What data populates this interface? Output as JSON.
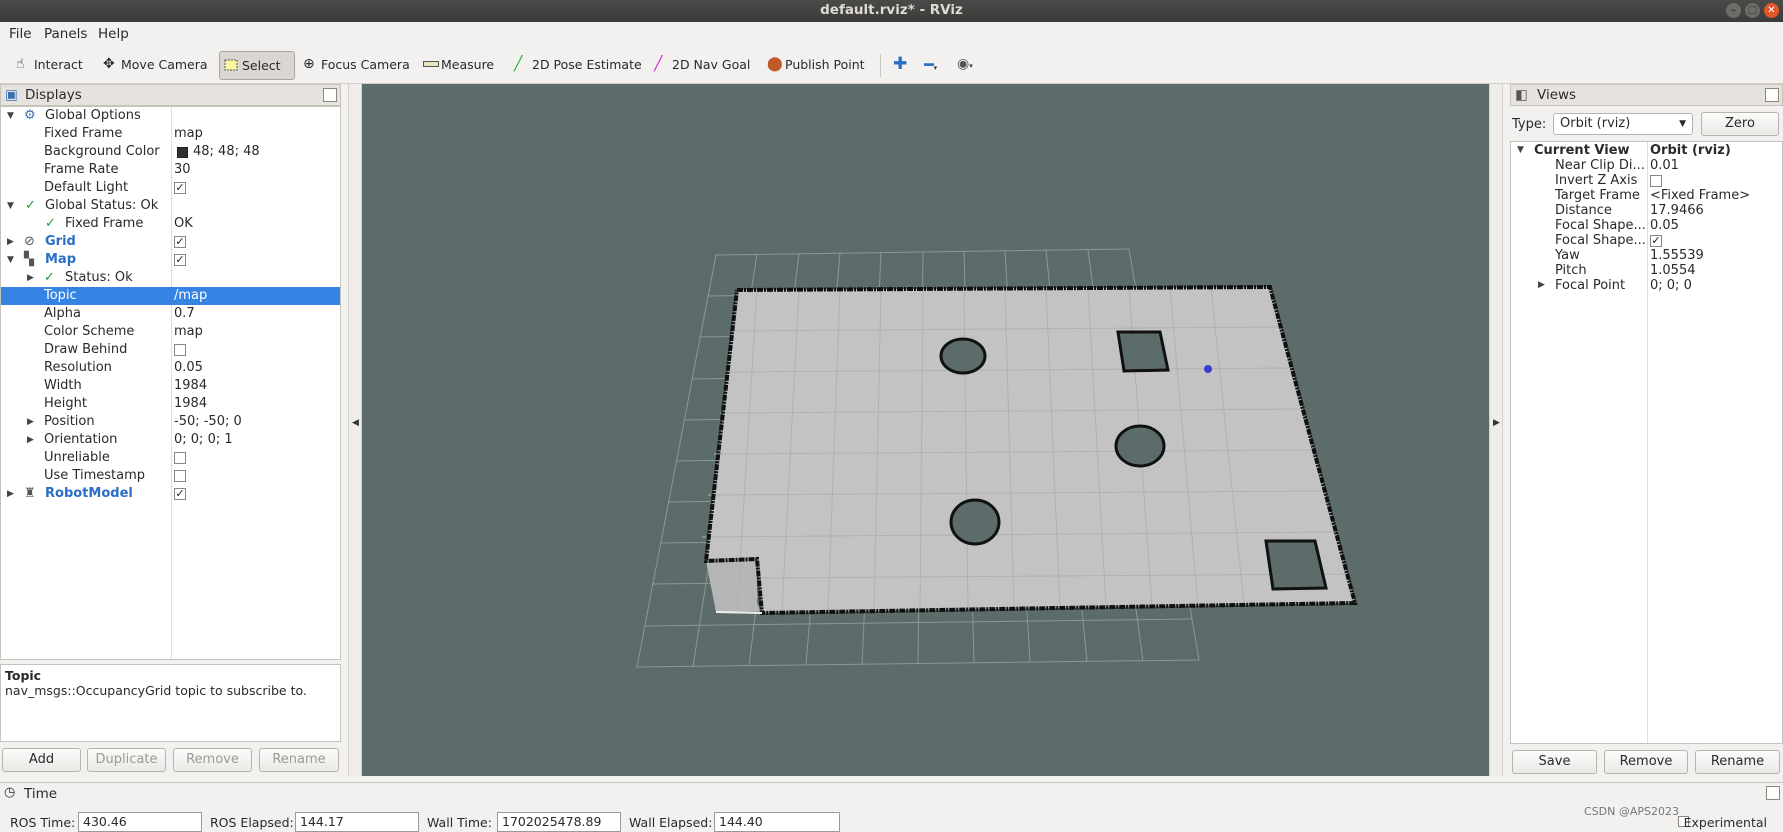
{
  "window": {
    "title": "default.rviz* - RViz"
  },
  "menu": {
    "file": "File",
    "panels": "Panels",
    "help": "Help"
  },
  "toolbar": {
    "interact": "Interact",
    "move_camera": "Move Camera",
    "select": "Select",
    "focus_camera": "Focus Camera",
    "measure": "Measure",
    "pose_estimate": "2D Pose Estimate",
    "nav_goal": "2D Nav Goal",
    "publish_point": "Publish Point"
  },
  "displays": {
    "title": "Displays",
    "global_options": "Global Options",
    "fixed_frame_label": "Fixed Frame",
    "fixed_frame_value": "map",
    "bg_color_label": "Background Color",
    "bg_color_value": "48; 48; 48",
    "bg_color_swatch": "#303030",
    "frame_rate_label": "Frame Rate",
    "frame_rate_value": "30",
    "default_light_label": "Default Light",
    "global_status": "Global Status: Ok",
    "status_fixed_frame_label": "Fixed Frame",
    "status_fixed_frame_value": "OK",
    "grid": "Grid",
    "map": "Map",
    "map_status": "Status: Ok",
    "topic_label": "Topic",
    "topic_value": "/map",
    "alpha_label": "Alpha",
    "alpha_value": "0.7",
    "color_scheme_label": "Color Scheme",
    "color_scheme_value": "map",
    "draw_behind_label": "Draw Behind",
    "resolution_label": "Resolution",
    "resolution_value": "0.05",
    "width_label": "Width",
    "width_value": "1984",
    "height_label": "Height",
    "height_value": "1984",
    "position_label": "Position",
    "position_value": "-50; -50; 0",
    "orientation_label": "Orientation",
    "orientation_value": "0; 0; 0; 1",
    "unreliable_label": "Unreliable",
    "use_timestamp_label": "Use Timestamp",
    "robot_model": "RobotModel"
  },
  "description": {
    "title": "Topic",
    "text": "nav_msgs::OccupancyGrid topic to subscribe to."
  },
  "display_buttons": {
    "add": "Add",
    "duplicate": "Duplicate",
    "remove": "Remove",
    "rename": "Rename"
  },
  "views": {
    "title": "Views",
    "type_label": "Type:",
    "type_value": "Orbit (rviz)",
    "zero": "Zero",
    "current_view": "Current View",
    "current_view_type": "Orbit (rviz)",
    "near_clip_label": "Near Clip Di...",
    "near_clip_value": "0.01",
    "invert_z_label": "Invert Z Axis",
    "target_frame_label": "Target Frame",
    "target_frame_value": "<Fixed Frame>",
    "distance_label": "Distance",
    "distance_value": "17.9466",
    "focal_shape1_label": "Focal Shape...",
    "focal_shape1_value": "0.05",
    "focal_shape2_label": "Focal Shape...",
    "yaw_label": "Yaw",
    "yaw_value": "1.55539",
    "pitch_label": "Pitch",
    "pitch_value": "1.0554",
    "focal_point_label": "Focal Point",
    "focal_point_value": "0; 0; 0",
    "save": "Save",
    "remove": "Remove",
    "rename": "Rename"
  },
  "time": {
    "title": "Time",
    "ros_time_label": "ROS Time:",
    "ros_time_value": "430.46",
    "ros_elapsed_label": "ROS Elapsed:",
    "ros_elapsed_value": "144.17",
    "wall_time_label": "Wall Time:",
    "wall_time_value": "1702025478.89",
    "wall_elapsed_label": "Wall Elapsed:",
    "wall_elapsed_value": "144.40",
    "experimental_label": "Experimental"
  },
  "watermark": "CSDN @APS2023"
}
